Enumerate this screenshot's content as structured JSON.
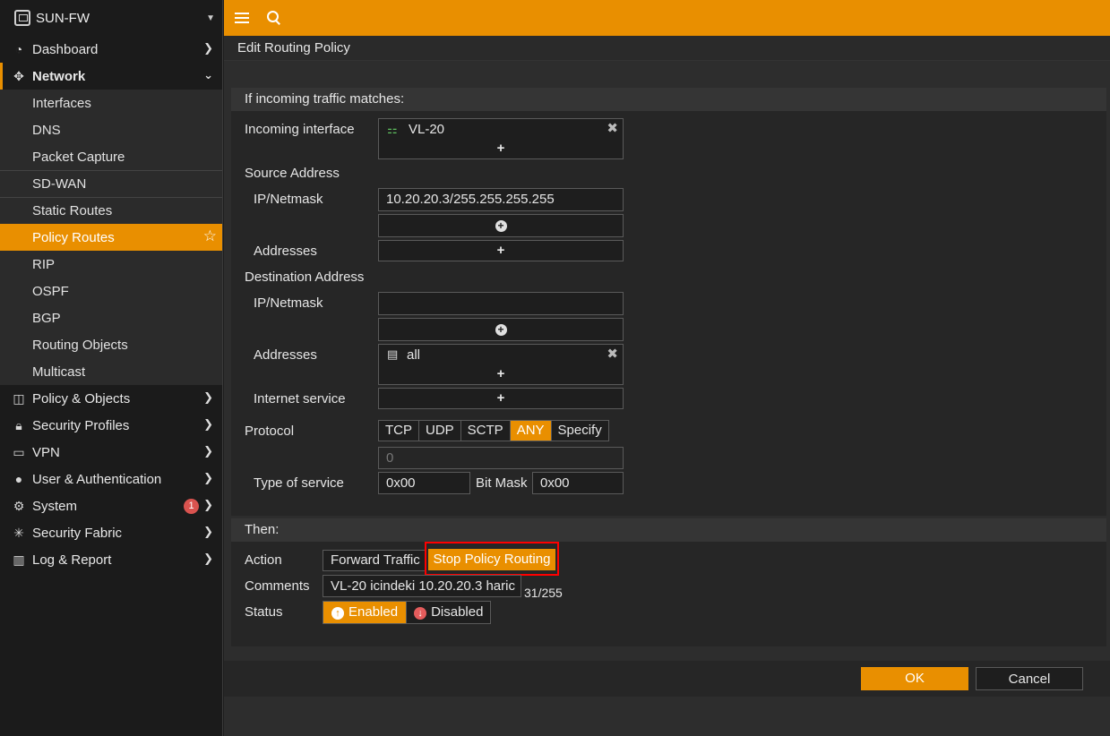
{
  "sidebar": {
    "device_name": "SUN-FW",
    "items": [
      {
        "label": "Dashboard"
      },
      {
        "label": "Network"
      },
      {
        "label": "Policy & Objects"
      },
      {
        "label": "Security Profiles"
      },
      {
        "label": "VPN"
      },
      {
        "label": "User & Authentication"
      },
      {
        "label": "System",
        "badge": "1"
      },
      {
        "label": "Security Fabric"
      },
      {
        "label": "Log & Report"
      }
    ],
    "network_sub": [
      "Interfaces",
      "DNS",
      "Packet Capture",
      "SD-WAN",
      "Static Routes",
      "Policy Routes",
      "RIP",
      "OSPF",
      "BGP",
      "Routing Objects",
      "Multicast"
    ]
  },
  "page_title": "Edit Routing Policy",
  "match": {
    "section_title": "If incoming traffic matches:",
    "incoming_interface_label": "Incoming interface",
    "incoming_interface_value": "VL-20",
    "source_address_label": "Source Address",
    "ip_netmask_label": "IP/Netmask",
    "source_ip_value": "10.20.20.3/255.255.255.255",
    "addresses_label": "Addresses",
    "destination_address_label": "Destination Address",
    "dest_ip_value": "",
    "dest_addresses_value": "all",
    "internet_service_label": "Internet service",
    "protocol_label": "Protocol",
    "protocol_options": [
      "TCP",
      "UDP",
      "SCTP",
      "ANY",
      "Specify"
    ],
    "protocol_selected": "ANY",
    "protocol_number": "0",
    "type_of_service_label": "Type of service",
    "tos_value": "0x00",
    "bit_mask_label": "Bit Mask",
    "bit_mask_value": "0x00"
  },
  "then": {
    "section_title": "Then:",
    "action_label": "Action",
    "action_options": [
      "Forward Traffic",
      "Stop Policy Routing"
    ],
    "action_selected": "Stop Policy Routing",
    "comments_label": "Comments",
    "comments_value": "VL-20 icindeki 10.20.20.3 haric",
    "comments_count": "31/255",
    "status_label": "Status",
    "status_enabled": "Enabled",
    "status_disabled": "Disabled"
  },
  "buttons": {
    "ok": "OK",
    "cancel": "Cancel"
  },
  "colors": {
    "accent": "#e98f00",
    "highlight_border": "#ff0000",
    "badge": "#d9534f"
  }
}
